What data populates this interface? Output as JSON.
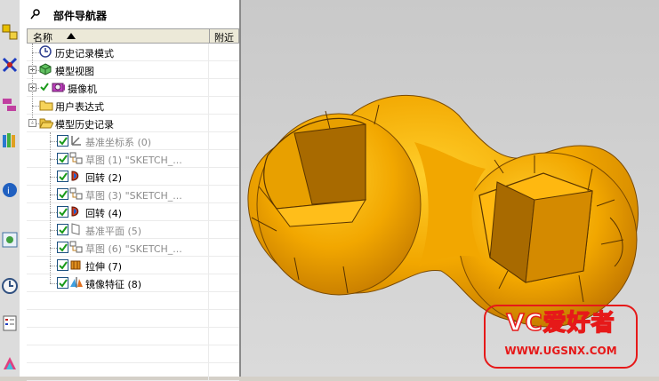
{
  "navigator": {
    "title": "部件导航器",
    "columns": {
      "name": "名称",
      "attach": "附近"
    },
    "items": [
      {
        "label": "历史记录模式",
        "level": 0,
        "expander": "",
        "checked": null,
        "icon": "clock",
        "dim": false
      },
      {
        "label": "模型视图",
        "level": 0,
        "expander": "+",
        "checked": null,
        "icon": "cube-view",
        "dim": false
      },
      {
        "label": "摄像机",
        "level": 0,
        "expander": "+",
        "checked": true,
        "icon": "camera",
        "dim": false
      },
      {
        "label": "用户表达式",
        "level": 0,
        "expander": "",
        "checked": null,
        "icon": "folder",
        "dim": false
      },
      {
        "label": "模型历史记录",
        "level": 0,
        "expander": "-",
        "checked": null,
        "icon": "folder-open",
        "dim": false
      },
      {
        "label": "基准坐标系 (0)",
        "level": 1,
        "expander": "",
        "checked": true,
        "icon": "datum-csys",
        "dim": true
      },
      {
        "label": "草图 (1) \"SKETCH_...",
        "level": 1,
        "expander": "",
        "checked": true,
        "icon": "sketch",
        "dim": true
      },
      {
        "label": "回转 (2)",
        "level": 1,
        "expander": "",
        "checked": true,
        "icon": "revolve",
        "dim": false
      },
      {
        "label": "草图 (3) \"SKETCH_...",
        "level": 1,
        "expander": "",
        "checked": true,
        "icon": "sketch",
        "dim": true
      },
      {
        "label": "回转 (4)",
        "level": 1,
        "expander": "",
        "checked": true,
        "icon": "revolve",
        "dim": false
      },
      {
        "label": "基准平面 (5)",
        "level": 1,
        "expander": "",
        "checked": true,
        "icon": "datum-plane",
        "dim": true
      },
      {
        "label": "草图 (6) \"SKETCH_...",
        "level": 1,
        "expander": "",
        "checked": true,
        "icon": "sketch",
        "dim": true
      },
      {
        "label": "拉伸 (7)",
        "level": 1,
        "expander": "",
        "checked": true,
        "icon": "extrude",
        "dim": false
      },
      {
        "label": "镜像特征 (8)",
        "level": 1,
        "expander": "",
        "checked": true,
        "icon": "mirror",
        "dim": false
      }
    ]
  },
  "resource_bar": [
    "assembly-navigator-icon",
    "constraint-navigator-icon",
    "part-navigator-icon",
    "reuse-library-icon",
    "web-browser-icon",
    "history-icon",
    "system-materials-icon",
    "process-studio-icon",
    "roles-icon"
  ],
  "watermark": {
    "text": "VC爱好者",
    "url": "WWW.UGSNX.COM"
  },
  "colors": {
    "model": "#f2a700",
    "model_dark": "#b36e00",
    "watermark": "#e61919"
  }
}
